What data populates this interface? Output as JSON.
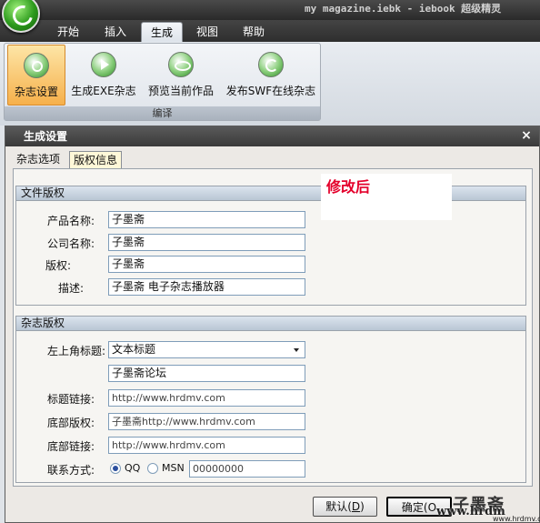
{
  "window": {
    "title": "my magazine.iebk - iebook 超级精灵"
  },
  "ribbon": {
    "tabs": [
      {
        "label": "开始"
      },
      {
        "label": "插入"
      },
      {
        "label": "生成",
        "active": true
      },
      {
        "label": "视图"
      },
      {
        "label": "帮助"
      }
    ],
    "buttons": [
      {
        "label": "杂志设置",
        "icon": "gear-icon",
        "selected": true
      },
      {
        "label": "生成EXE杂志",
        "icon": "play-icon"
      },
      {
        "label": "预览当前作品",
        "icon": "eye-icon"
      },
      {
        "label": "发布SWF在线杂志",
        "icon": "refresh-icon"
      }
    ],
    "group_label": "编译"
  },
  "dialog": {
    "title": "生成设置",
    "close_glyph": "×",
    "tabs": [
      {
        "label": "杂志选项"
      },
      {
        "label": "版权信息",
        "active": true
      }
    ],
    "annotation": "修改后",
    "file_copyright": {
      "header": "文件版权",
      "fields": [
        {
          "label": "产品名称:",
          "value": "子墨斋"
        },
        {
          "label": "公司名称:",
          "value": "子墨斋"
        },
        {
          "label": "版权:",
          "value": "子墨斋"
        },
        {
          "label": "描述:",
          "value": "子墨斋 电子杂志播放器"
        }
      ]
    },
    "magazine_copyright": {
      "header": "杂志版权",
      "title_label": "左上角标题:",
      "title_type_value": "文本标题",
      "title_text_value": "子墨斋论坛",
      "title_link_label": "标题链接:",
      "title_link_value": "http://www.hrdmv.com",
      "footer_copyright_label": "底部版权:",
      "footer_copyright_value": "子墨斋http://www.hrdmv.com",
      "footer_link_label": "底部链接:",
      "footer_link_value": "http://www.hrdmv.com",
      "contact_label": "联系方式:",
      "contact_options": [
        "QQ",
        "MSN"
      ],
      "contact_selected": "QQ",
      "contact_value": "00000000"
    },
    "buttons": {
      "default_label": "默认(",
      "default_key": "D",
      "default_close": ")",
      "ok_label": "确定(O"
    }
  },
  "watermark": {
    "seal": "子墨斋",
    "url": "www.hrdm",
    "url_small": "www.hrdmv.com"
  }
}
